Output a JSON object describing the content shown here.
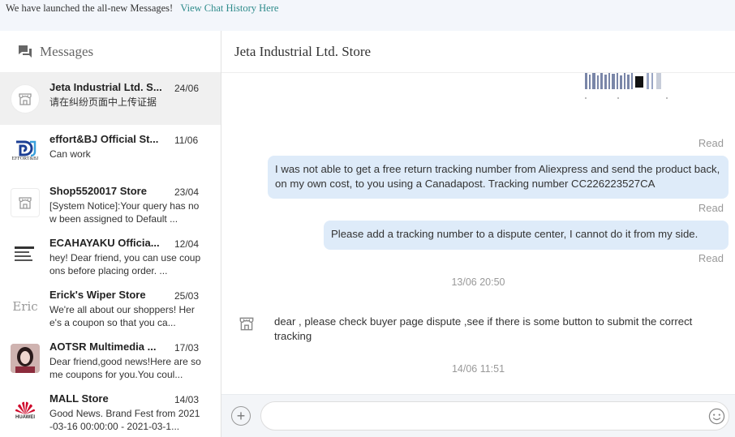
{
  "banner": {
    "text": "We have launched the all-new Messages!",
    "link": "View Chat History Here"
  },
  "sidebar": {
    "title": "Messages",
    "conversations": [
      {
        "name": "Jeta Industrial Ltd. S...",
        "date": "24/06",
        "preview": "请在纠纷页面中上传证据",
        "avatar": "store-icon"
      },
      {
        "name": "effort&BJ Official St...",
        "date": "11/06",
        "preview": "Can work",
        "avatar": "effort-logo",
        "logo_text": "EFFORT&BJ"
      },
      {
        "name": "Shop5520017 Store",
        "date": "23/04",
        "preview": "[System Notice]:Your query has now been assigned to Default ...",
        "avatar": "store-icon"
      },
      {
        "name": "ECAHAYAKU Officia...",
        "date": "12/04",
        "preview": "hey! Dear friend, you can use coupons before placing order. ...",
        "avatar": "ecahayaku-logo"
      },
      {
        "name": "Erick's Wiper Store",
        "date": "25/03",
        "preview": "We're all about our shoppers! Here's a coupon so that you ca...",
        "avatar": "eric-logo",
        "logo_text": "Eric"
      },
      {
        "name": "AOTSR Multimedia ...",
        "date": "17/03",
        "preview": "Dear friend,good news!Here are some coupons for you.You coul...",
        "avatar": "photo-avatar"
      },
      {
        "name": "MALL Store",
        "date": "14/03",
        "preview": "Good News. Brand Fest from 2021-03-16 00:00:00 - 2021-03-1...",
        "avatar": "huawei-logo",
        "logo_text": "HUAWEI"
      }
    ]
  },
  "chat": {
    "title": "Jeta Industrial Ltd. Store",
    "read_label": "Read",
    "msg1": "I was not able to get a free return tracking number from Aliexpress  and send the product back, on my own cost, to you using a Canadapost. Tracking number CC226223527CA",
    "msg2": "Please add a tracking number to a dispute center, I cannot do it from my side.",
    "ts1": "13/06 20:50",
    "msg3": "dear , please  check buyer page dispute  ,see if there is some button to submit the correct tracking",
    "ts2": "14/06 11:51",
    "input_value": ""
  },
  "colors": {
    "banner_bg": "#f3f6fb",
    "link": "#2e8b8b",
    "bubble": "#deebf9",
    "active_row": "#f0f0f0",
    "huawei_red": "#cf0a2c"
  }
}
